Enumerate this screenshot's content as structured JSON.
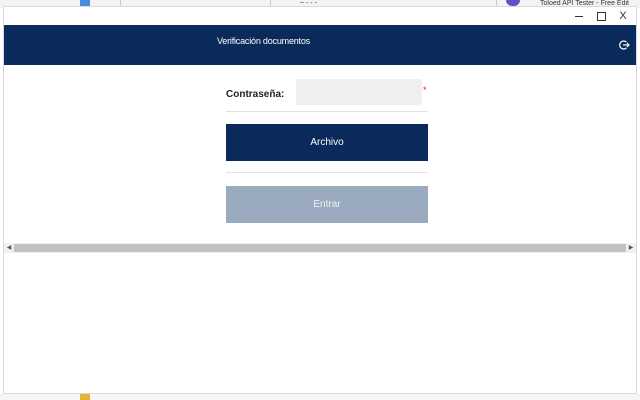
{
  "background": {
    "tab_snippet": "Toloed API Tester - Free Edit",
    "left_snippet": "~ - - -"
  },
  "window": {
    "controls": {
      "minimize": "minimize",
      "maximize": "maximize",
      "close": "X"
    }
  },
  "app": {
    "title": "Verificación documentos",
    "logout_icon": "logout-icon"
  },
  "form": {
    "password_label": "Contraseña:",
    "password_value": "",
    "required_mark": "*",
    "archivo_button": "Archivo",
    "entrar_button": "Entrar",
    "entrar_enabled": false
  },
  "scrollbar": {
    "left_arrow": "◀",
    "right_arrow": "▶"
  },
  "colors": {
    "header": "#0a2a5b",
    "primary_button": "#0a2a5b",
    "disabled_button": "#9aabc0",
    "input_bg": "#efefef",
    "required": "#d82020"
  }
}
